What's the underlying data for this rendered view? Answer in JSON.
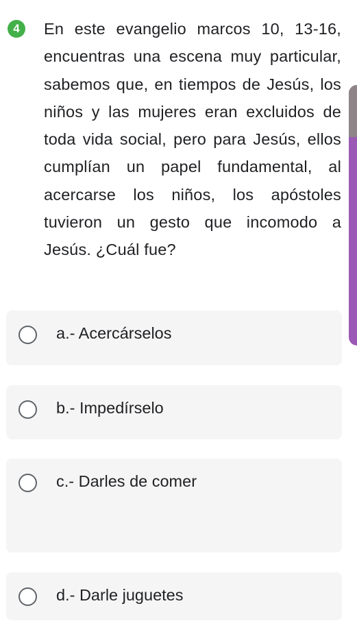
{
  "question": {
    "number": "4",
    "text": "En este evangelio marcos 10, 13-16, encuentras una escena muy particular, sabemos que, en tiempos de Jesús, los niños y las mujeres eran excluidos de toda vida social, pero para Jesús, ellos cumplían un papel fundamental, al acercarse los niños, los apóstoles tuvieron un gesto que incomodo a Jesús. ¿Cuál fue?",
    "badge_color": "#43b049"
  },
  "options": [
    {
      "label": "a.- Acercárselos",
      "selected": false
    },
    {
      "label": "b.- Impedírselo",
      "selected": false
    },
    {
      "label": "c.- Darles de comer",
      "selected": false
    },
    {
      "label": "d.- Darle juguetes",
      "selected": false
    }
  ],
  "colors": {
    "option_background": "#f5f5f5",
    "scroll_accent": "#9b59b6",
    "scroll_top": "#8f8588"
  }
}
